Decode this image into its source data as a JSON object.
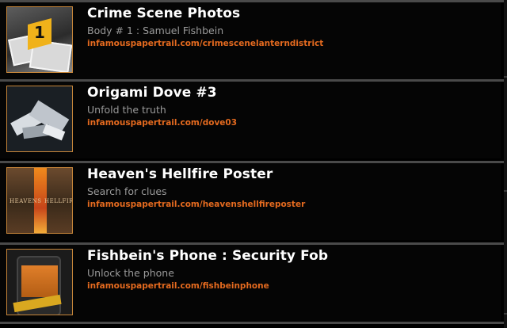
{
  "items": [
    {
      "title": "Crime Scene Photos",
      "subtitle": "Body # 1 : Samuel Fishbein",
      "link": "infamouspapertrail.com/crimescenelanterndistrict",
      "thumb_icon": "crime-scene-marker-icon"
    },
    {
      "title": "Origami Dove #3",
      "subtitle": "Unfold the truth",
      "link": "infamouspapertrail.com/dove03",
      "thumb_icon": "origami-dove-icon"
    },
    {
      "title": "Heaven's Hellfire Poster",
      "subtitle": "Search for clues",
      "link": "infamouspapertrail.com/heavenshellfireposter",
      "thumb_icon": "poster-icon"
    },
    {
      "title": "Fishbein's Phone : Security Fob",
      "subtitle": "Unlock the phone",
      "link": "infamouspapertrail.com/fishbeinphone",
      "thumb_icon": "phone-icon"
    }
  ],
  "poster_text": {
    "left": "HEAVENS",
    "right": "HELLFIRE"
  },
  "colors": {
    "background": "#000000",
    "title": "#ffffff",
    "subtitle": "#9a9a9a",
    "link": "#e46a1f",
    "thumb_border": "#c7863a",
    "separator": "#4a4a4a"
  }
}
